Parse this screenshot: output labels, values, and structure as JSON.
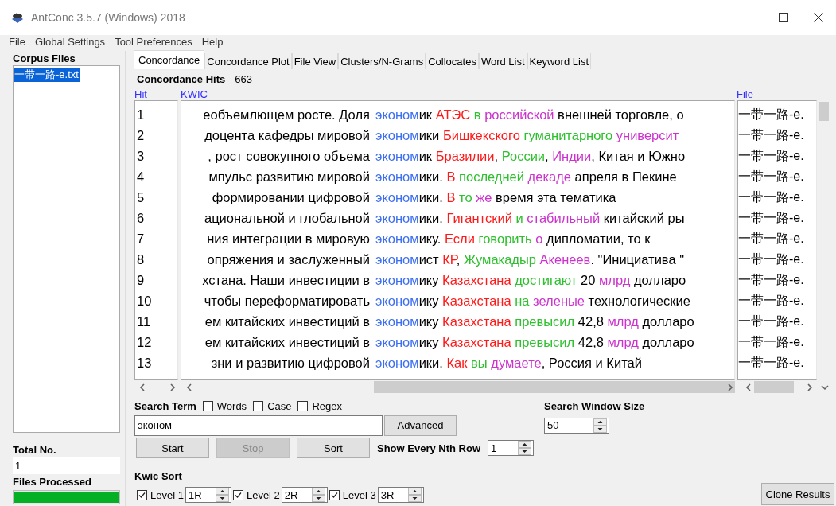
{
  "window": {
    "title": "AntConc 3.5.7 (Windows) 2018"
  },
  "menu": [
    "File",
    "Global Settings",
    "Tool Preferences",
    "Help"
  ],
  "sidebar": {
    "heading": "Corpus Files",
    "files": [
      {
        "name": "一带一路-e.txt",
        "selected": true
      }
    ],
    "total_label": "Total No.",
    "total_value": "1",
    "processed_label": "Files Processed",
    "progress": {
      "level": 1
    }
  },
  "tabs": [
    {
      "label": "Concordance",
      "selected": true
    },
    {
      "label": "Concordance Plot",
      "selected": false
    },
    {
      "label": "File View",
      "selected": false
    },
    {
      "label": "Clusters/N-Grams",
      "selected": false
    },
    {
      "label": "Collocates",
      "selected": false
    },
    {
      "label": "Word List",
      "selected": false
    },
    {
      "label": "Keyword List",
      "selected": false
    }
  ],
  "hits": {
    "label": "Concordance Hits",
    "value": "663"
  },
  "table": {
    "columns": [
      "Hit",
      "KWIC",
      "File"
    ],
    "rows": [
      {
        "hit": "1",
        "left": "еобъемлющем росте. Доля",
        "kwic": [
          {
            "text": "эконом",
            "color": "#3d6ff0"
          },
          {
            "text": "ик "
          },
          {
            "text": "АТЭС",
            "color": "#ff1a1a"
          },
          {
            "text": " в",
            "color": "#2ec02e"
          },
          {
            "text": " российской",
            "color": "#cc33cc"
          },
          {
            "text": " внешней торговле, о"
          }
        ],
        "file": "一带一路-e."
      },
      {
        "hit": "2",
        "left": "доцента кафедры мировой",
        "kwic": [
          {
            "text": "эконом",
            "color": "#3d6ff0"
          },
          {
            "text": "ики "
          },
          {
            "text": "Бишкекского",
            "color": "#ff1a1a"
          },
          {
            "text": " гуманитарного",
            "color": "#2ec02e"
          },
          {
            "text": " университ",
            "color": "#cc33cc"
          }
        ],
        "file": "一带一路-e."
      },
      {
        "hit": "3",
        "left": ", рост совокупного объема",
        "kwic": [
          {
            "text": "эконом",
            "color": "#3d6ff0"
          },
          {
            "text": "ик "
          },
          {
            "text": "Бразилии",
            "color": "#ff1a1a"
          },
          {
            "text": ", "
          },
          {
            "text": "России",
            "color": "#2ec02e"
          },
          {
            "text": ", "
          },
          {
            "text": "Индии",
            "color": "#cc33cc"
          },
          {
            "text": ", Китая и Южно"
          }
        ],
        "file": "一带一路-e."
      },
      {
        "hit": "4",
        "left": "мпульс развитию мировой",
        "kwic": [
          {
            "text": "эконом",
            "color": "#3d6ff0"
          },
          {
            "text": "ики. "
          },
          {
            "text": "В",
            "color": "#ff1a1a"
          },
          {
            "text": " последней",
            "color": "#2ec02e"
          },
          {
            "text": " декаде",
            "color": "#cc33cc"
          },
          {
            "text": " апреля в Пекине"
          }
        ],
        "file": "一带一路-e."
      },
      {
        "hit": "5",
        "left": "формировании цифровой",
        "kwic": [
          {
            "text": "эконом",
            "color": "#3d6ff0"
          },
          {
            "text": "ики. "
          },
          {
            "text": "В",
            "color": "#ff1a1a"
          },
          {
            "text": " то",
            "color": "#2ec02e"
          },
          {
            "text": " же",
            "color": "#cc33cc"
          },
          {
            "text": " время эта тематика"
          }
        ],
        "file": "一带一路-e."
      },
      {
        "hit": "6",
        "left": "ациональной и глобальной",
        "kwic": [
          {
            "text": "эконом",
            "color": "#3d6ff0"
          },
          {
            "text": "ики. "
          },
          {
            "text": "Гигантский",
            "color": "#ff1a1a"
          },
          {
            "text": " и",
            "color": "#2ec02e"
          },
          {
            "text": " стабильный",
            "color": "#cc33cc"
          },
          {
            "text": " китайский ры"
          }
        ],
        "file": "一带一路-e."
      },
      {
        "hit": "7",
        "left": "ния интеграции в мировую",
        "kwic": [
          {
            "text": "эконом",
            "color": "#3d6ff0"
          },
          {
            "text": "ику. "
          },
          {
            "text": "Если",
            "color": "#ff1a1a"
          },
          {
            "text": " говорить",
            "color": "#2ec02e"
          },
          {
            "text": " о",
            "color": "#cc33cc"
          },
          {
            "text": " дипломатии, то к"
          }
        ],
        "file": "一带一路-e."
      },
      {
        "hit": "8",
        "left": "опряжения и заслуженный",
        "kwic": [
          {
            "text": "эконом",
            "color": "#3d6ff0"
          },
          {
            "text": "ист "
          },
          {
            "text": "КР",
            "color": "#ff1a1a"
          },
          {
            "text": ", "
          },
          {
            "text": "Жумакадыр",
            "color": "#2ec02e"
          },
          {
            "text": " Акенеев",
            "color": "#cc33cc"
          },
          {
            "text": ". \"Инициатива \""
          }
        ],
        "file": "一带一路-e."
      },
      {
        "hit": "9",
        "left": "хстана. Наши инвестиции в",
        "kwic": [
          {
            "text": "эконом",
            "color": "#3d6ff0"
          },
          {
            "text": "ику "
          },
          {
            "text": "Казахстана",
            "color": "#ff1a1a"
          },
          {
            "text": " достигают",
            "color": "#2ec02e"
          },
          {
            "text": " 20 "
          },
          {
            "text": "млрд",
            "color": "#cc33cc"
          },
          {
            "text": " долларо"
          }
        ],
        "file": "一带一路-e."
      },
      {
        "hit": "10",
        "left": "чтобы переформатировать",
        "kwic": [
          {
            "text": "эконом",
            "color": "#3d6ff0"
          },
          {
            "text": "ику "
          },
          {
            "text": "Казахстана",
            "color": "#ff1a1a"
          },
          {
            "text": " на",
            "color": "#2ec02e"
          },
          {
            "text": " зеленые",
            "color": "#cc33cc"
          },
          {
            "text": " технологические"
          }
        ],
        "file": "一带一路-e."
      },
      {
        "hit": "11",
        "left": "ем китайских инвестиций в",
        "kwic": [
          {
            "text": "эконом",
            "color": "#3d6ff0"
          },
          {
            "text": "ику "
          },
          {
            "text": "Казахстана",
            "color": "#ff1a1a"
          },
          {
            "text": " превысил",
            "color": "#2ec02e"
          },
          {
            "text": " 42,8 "
          },
          {
            "text": "млрд",
            "color": "#cc33cc"
          },
          {
            "text": " долларо"
          }
        ],
        "file": "一带一路-e."
      },
      {
        "hit": "12",
        "left": "ем китайских инвестиций в",
        "kwic": [
          {
            "text": "эконом",
            "color": "#3d6ff0"
          },
          {
            "text": "ику "
          },
          {
            "text": "Казахстана",
            "color": "#ff1a1a"
          },
          {
            "text": " превысил",
            "color": "#2ec02e"
          },
          {
            "text": " 42,8 "
          },
          {
            "text": "млрд",
            "color": "#cc33cc"
          },
          {
            "text": " долларо"
          }
        ],
        "file": "一带一路-e."
      },
      {
        "hit": "13",
        "left": "зни и развитию цифровой",
        "kwic": [
          {
            "text": "эконом",
            "color": "#3d6ff0"
          },
          {
            "text": "ики. "
          },
          {
            "text": "Как",
            "color": "#ff1a1a"
          },
          {
            "text": " вы",
            "color": "#2ec02e"
          },
          {
            "text": " думаете",
            "color": "#cc33cc"
          },
          {
            "text": ", Россия и Китай"
          }
        ],
        "file": "一带一路-e."
      }
    ]
  },
  "search": {
    "label": "Search Term",
    "options": [
      {
        "label": "Words",
        "checked": false
      },
      {
        "label": "Case",
        "checked": false
      },
      {
        "label": "Regex",
        "checked": false
      }
    ],
    "value": "эконом",
    "advanced": "Advanced",
    "window_size_label": "Search Window Size",
    "window_size": "50"
  },
  "buttons": [
    {
      "label": "Start",
      "disabled": false
    },
    {
      "label": "Stop",
      "disabled": true
    },
    {
      "label": "Sort",
      "disabled": false
    }
  ],
  "nth_row": {
    "label": "Show Every Nth Row",
    "value": "1"
  },
  "kwic_sort": {
    "label": "Kwic Sort",
    "levels": [
      {
        "label": "Level 1",
        "checked": true,
        "value": "1R"
      },
      {
        "label": "Level 2",
        "checked": true,
        "value": "2R"
      },
      {
        "label": "Level 3",
        "checked": true,
        "value": "3R"
      }
    ]
  },
  "clone_button": "Clone Results"
}
